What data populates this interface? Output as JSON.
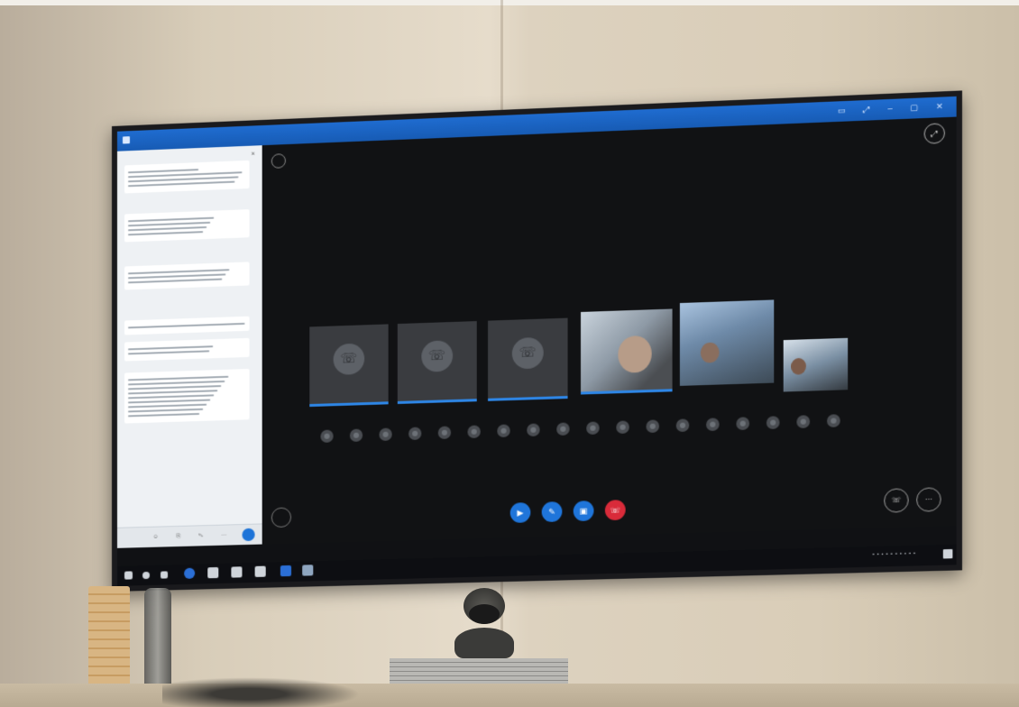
{
  "tv_screen": {
    "title_bar": {
      "title": "",
      "controls": [
        "▭",
        "⤢",
        "–",
        "▢",
        "✕"
      ]
    },
    "chat_panel": {
      "header": "",
      "close_icon": "×",
      "messages": [
        {
          "lines": 4
        },
        {
          "lines": 4
        },
        {
          "lines": 3
        },
        {
          "lines": 1
        },
        {
          "lines": 2
        },
        {
          "lines": 9
        }
      ]
    },
    "meeting": {
      "room_name": "",
      "network_status": "",
      "audio_tiles": [
        {
          "name": ""
        },
        {
          "name": ""
        },
        {
          "name": ""
        }
      ],
      "video_tiles": [
        {
          "name": ""
        },
        {
          "name": ""
        },
        {
          "name": ""
        }
      ],
      "participant_dot_count": 18,
      "controls": [
        {
          "name": "camera-button",
          "color": "#1f75da"
        },
        {
          "name": "mic-button",
          "color": "#1f75da"
        },
        {
          "name": "share-button",
          "color": "#1f75da"
        },
        {
          "name": "hangup-button",
          "color": "#d92b3a"
        }
      ]
    },
    "taskbar": {
      "clock_time": "",
      "clock_date": ""
    }
  },
  "colors": {
    "accent": "#1d6fd6",
    "hangup": "#d92b3a",
    "screen_bg": "#111214"
  }
}
